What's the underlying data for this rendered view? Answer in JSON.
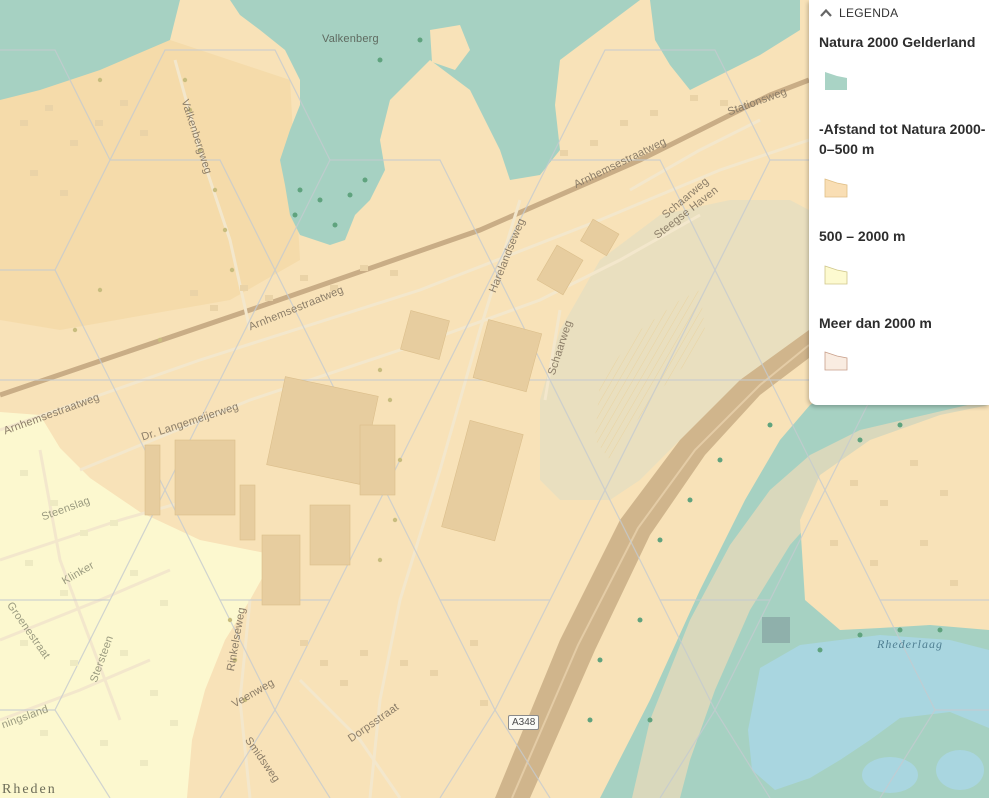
{
  "legend": {
    "toggle_label": "LEGENDA",
    "layer_title": "Natura 2000 Gelderland",
    "items": [
      {
        "label": "",
        "color": "#a9d3c5"
      },
      {
        "label": "-Afstand tot Natura 2000- 0–500 m",
        "color": "#f9deb4"
      },
      {
        "label": "500 – 2000 m",
        "color": "#fdfad0"
      },
      {
        "label": "Meer dan 2000 m",
        "color": "#f9ece1"
      }
    ]
  },
  "map": {
    "colors": {
      "zone_0_500": "#f8e2b8",
      "zone_500_2000": "#fcf8cf",
      "natura": "#a6d1c2",
      "water": "#a9d6e0",
      "river": "#d9d8bc",
      "motorway": "#d0b58c",
      "building": "#e7cd9f"
    },
    "labels": {
      "valkenberg": "Valkenberg",
      "valkenbergweg": "Valkenbergweg",
      "stationsweg": "Stationsweg",
      "arnhemsestraatweg_1": "Arnhemsestraatweg",
      "arnhemsestraatweg_2": "Arnhemsestraatweg",
      "arnhemsestraatweg_3": "Arnhemsestraatweg",
      "schaarweg_1": "Schaarweg",
      "schaarweg_2": "Schaarweg",
      "steegse_haven": "Steegse Haven",
      "harelandseweg": "Harelandseweg",
      "dr_langemeijerweg": "Dr. Langemeijerweg",
      "steenslag": "Steenslag",
      "klinker": "Klinker",
      "groenestraat": "Groenestraat",
      "stersteen": "Stersteen",
      "ningsland": "ningsland",
      "rinkelseweg": "Rinkelseweg",
      "veenweg": "Veenweg",
      "smidsweg": "Smidsweg",
      "dorpsstraat": "Dorpsstraat",
      "rhederlaag": "Rhederlaag",
      "rheden": "Rheden"
    },
    "road_shield": "A348"
  }
}
